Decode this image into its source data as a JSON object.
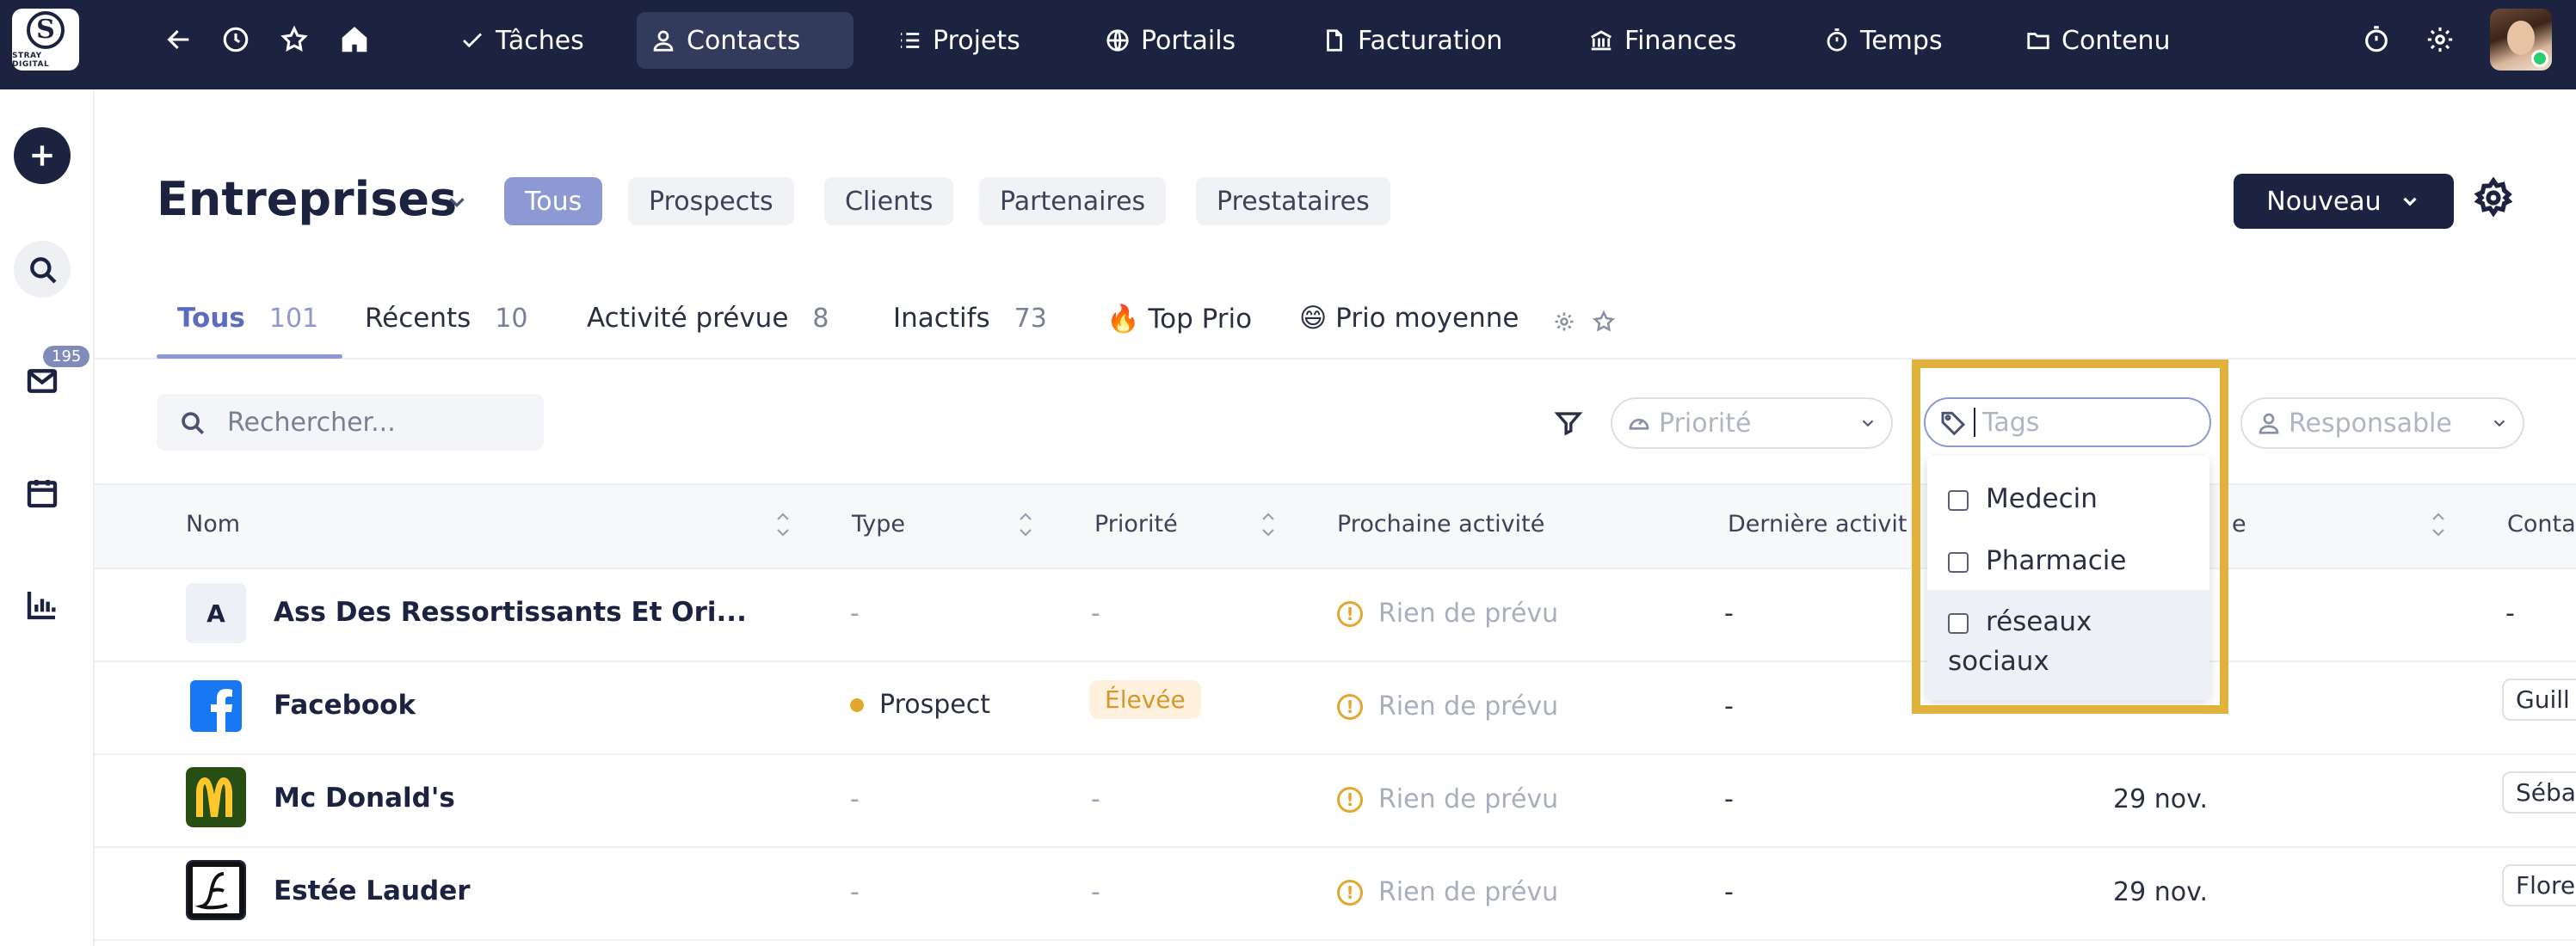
{
  "brand": {
    "logo_letter": "S",
    "logo_text": "STRAY DIGITAL"
  },
  "topnav": {
    "items": [
      {
        "label": "Tâches",
        "icon": "check-icon"
      },
      {
        "label": "Contacts",
        "icon": "user-icon",
        "active": true
      },
      {
        "label": "Projets",
        "icon": "list-icon"
      },
      {
        "label": "Portails",
        "icon": "globe-icon"
      },
      {
        "label": "Facturation",
        "icon": "file-icon"
      },
      {
        "label": "Finances",
        "icon": "bank-icon"
      },
      {
        "label": "Temps",
        "icon": "stopwatch-icon"
      },
      {
        "label": "Contenu",
        "icon": "folder-icon"
      }
    ]
  },
  "rail": {
    "mail_badge": "195"
  },
  "header": {
    "title": "Entreprises",
    "filters": [
      "Tous",
      "Prospects",
      "Clients",
      "Partenaires",
      "Prestataires"
    ],
    "new_button": "Nouveau"
  },
  "tabs": [
    {
      "label": "Tous",
      "count": "101"
    },
    {
      "label": "Récents",
      "count": "10"
    },
    {
      "label": "Activité prévue",
      "count": "8"
    },
    {
      "label": "Inactifs",
      "count": "73"
    },
    {
      "label": "🔥 Top Prio",
      "count": ""
    },
    {
      "label": "😄 Prio moyenne",
      "count": ""
    }
  ],
  "search": {
    "placeholder": "Rechercher..."
  },
  "selects": {
    "priority": "Priorité",
    "tags": "Tags",
    "owner": "Responsable"
  },
  "tags_options": [
    "Medecin",
    "Pharmacie",
    "réseaux sociaux"
  ],
  "columns": {
    "name": "Nom",
    "type": "Type",
    "priority": "Priorité",
    "next": "Prochaine activité",
    "last": "Dernière activit",
    "created": "e",
    "contact": "Conta"
  },
  "rows": [
    {
      "initial": "A",
      "name": "Ass Des Ressortissants Et Ori...",
      "type": "-",
      "priority": "-",
      "next": "Rien de prévu",
      "last": "-",
      "created": "",
      "owner": "-"
    },
    {
      "initial": "",
      "name": "Facebook",
      "type": "Prospect",
      "priority": "Élevée",
      "next": "Rien de prévu",
      "last": "-",
      "created": "",
      "owner": "Guill"
    },
    {
      "initial": "",
      "name": "Mc Donald's",
      "type": "-",
      "priority": "-",
      "next": "Rien de prévu",
      "last": "-",
      "created": "29 nov.",
      "owner": "Séba"
    },
    {
      "initial": "",
      "name": "Estée Lauder",
      "type": "-",
      "priority": "-",
      "next": "Rien de prévu",
      "last": "-",
      "created": "29 nov.",
      "owner": "Flore"
    }
  ],
  "colors": {
    "navy": "#1c2340",
    "accent": "#8c99d2",
    "highlight": "#e0b23d",
    "warn": "#e3a72f"
  }
}
